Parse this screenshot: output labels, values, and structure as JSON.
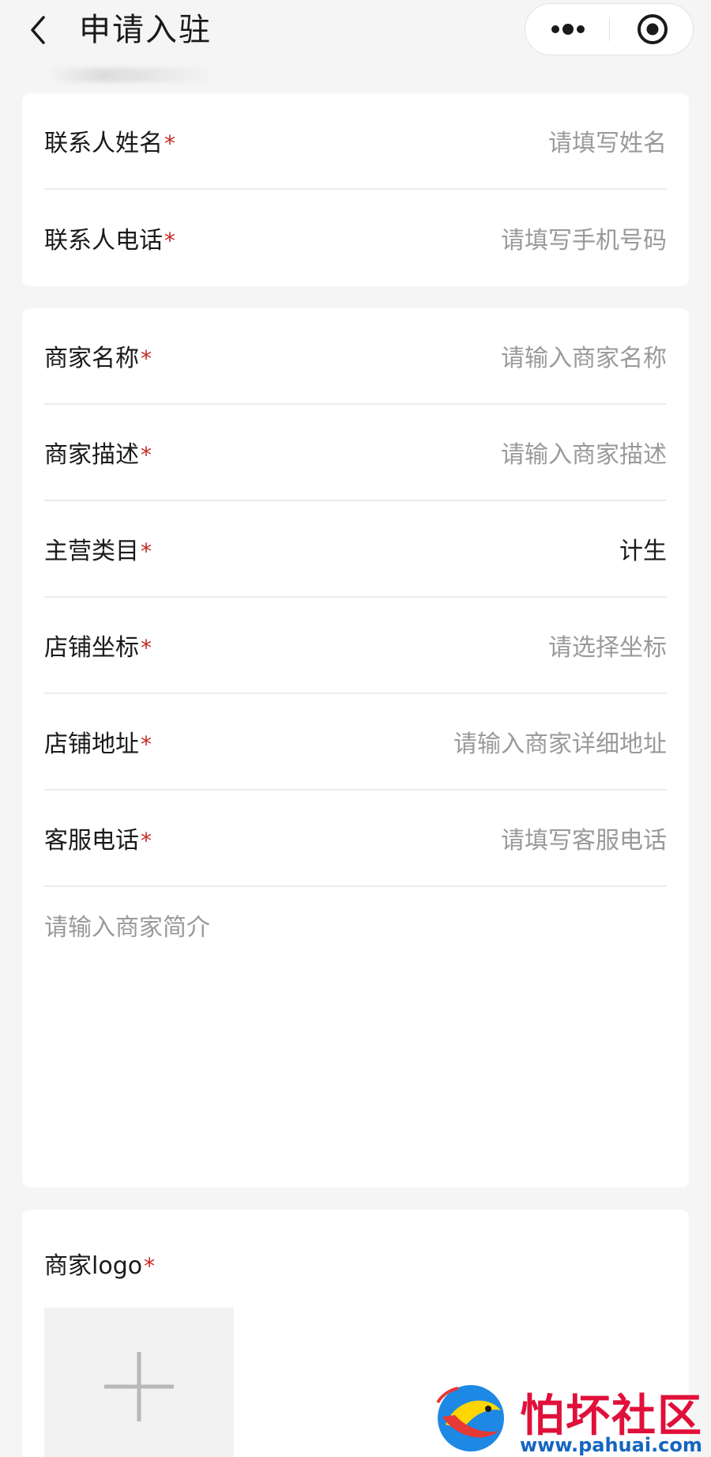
{
  "header": {
    "title": "申请入驻",
    "back_icon": "chevron-left-icon",
    "more_icon": "more-dots-icon",
    "close_icon": "record-circle-icon"
  },
  "contact_section": {
    "rows": [
      {
        "label": "联系人姓名",
        "required_mark": "*",
        "placeholder": "请填写姓名",
        "value": ""
      },
      {
        "label": "联系人电话",
        "required_mark": "*",
        "placeholder": "请填写手机号码",
        "value": ""
      }
    ]
  },
  "merchant_section": {
    "rows": [
      {
        "label": "商家名称",
        "required_mark": "*",
        "placeholder": "请输入商家名称",
        "value": ""
      },
      {
        "label": "商家描述",
        "required_mark": "*",
        "placeholder": "请输入商家描述",
        "value": ""
      },
      {
        "label": "主营类目",
        "required_mark": "*",
        "placeholder": "",
        "value": "计生"
      },
      {
        "label": "店铺坐标",
        "required_mark": "*",
        "placeholder": "请选择坐标",
        "value": ""
      },
      {
        "label": "店铺地址",
        "required_mark": "*",
        "placeholder": "请输入商家详细地址",
        "value": ""
      },
      {
        "label": "客服电话",
        "required_mark": "*",
        "placeholder": "请填写客服电话",
        "value": ""
      }
    ],
    "intro_placeholder": "请输入商家简介"
  },
  "logo_section": {
    "label": "商家logo",
    "required_mark": "*",
    "upload_icon": "plus-icon"
  },
  "watermark": {
    "text": "怕坏社区",
    "url": "www.pahuai.com",
    "logo_icon": "fish-logo-icon"
  },
  "colors": {
    "background": "#f5f5f5",
    "card": "#ffffff",
    "required": "#c62828",
    "placeholder": "#9a9a9a",
    "watermark_red": "#e0103a",
    "watermark_blue": "#1565c0"
  }
}
